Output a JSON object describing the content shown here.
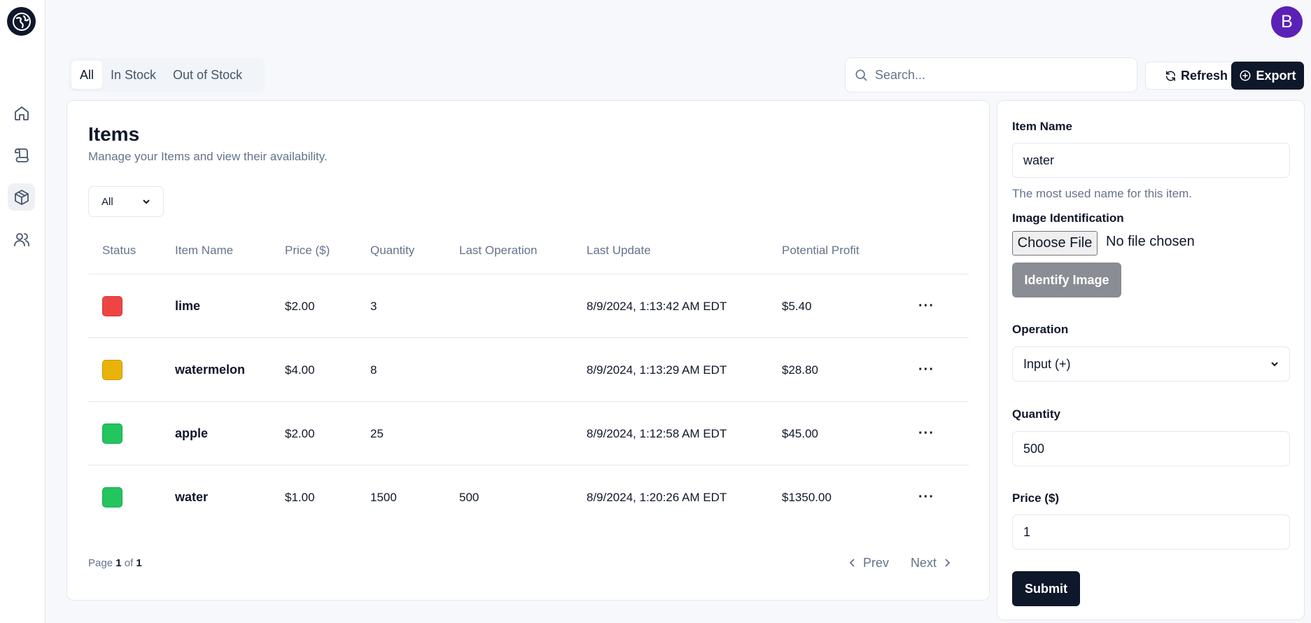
{
  "header": {
    "avatar_initial": "B"
  },
  "tabs": [
    {
      "label": "All",
      "active": true
    },
    {
      "label": "In Stock",
      "active": false
    },
    {
      "label": "Out of Stock",
      "active": false
    }
  ],
  "search": {
    "placeholder": "Search..."
  },
  "toolbar": {
    "refresh_label": "Refresh",
    "export_label": "Export"
  },
  "items_card": {
    "title": "Items",
    "subtitle": "Manage your Items and view their availability.",
    "filter_value": "All",
    "columns": [
      "Status",
      "Item Name",
      "Price ($)",
      "Quantity",
      "Last Operation",
      "Last Update",
      "Potential Profit"
    ],
    "rows": [
      {
        "status_color": "#ef4444",
        "name": "lime",
        "price": "$2.00",
        "quantity": "3",
        "last_operation": "",
        "last_update": "8/9/2024, 1:13:42 AM EDT",
        "profit": "$5.40"
      },
      {
        "status_color": "#eab308",
        "name": "watermelon",
        "price": "$4.00",
        "quantity": "8",
        "last_operation": "",
        "last_update": "8/9/2024, 1:13:29 AM EDT",
        "profit": "$28.80"
      },
      {
        "status_color": "#22c55e",
        "name": "apple",
        "price": "$2.00",
        "quantity": "25",
        "last_operation": "",
        "last_update": "8/9/2024, 1:12:58 AM EDT",
        "profit": "$45.00"
      },
      {
        "status_color": "#22c55e",
        "name": "water",
        "price": "$1.00",
        "quantity": "1500",
        "last_operation": "500",
        "last_update": "8/9/2024, 1:20:26 AM EDT",
        "profit": "$1350.00"
      }
    ],
    "pagination": {
      "page_word": "Page",
      "current": "1",
      "of_word": "of",
      "total": "1",
      "prev_label": "Prev",
      "next_label": "Next"
    }
  },
  "form": {
    "item_name_label": "Item Name",
    "item_name_value": "water",
    "item_name_hint": "The most used name for this item.",
    "image_label": "Image Identification",
    "choose_file_label": "Choose File",
    "no_file_text": "No file chosen",
    "identify_label": "Identify Image",
    "operation_label": "Operation",
    "operation_value": "Input (+)",
    "quantity_label": "Quantity",
    "quantity_value": "500",
    "price_label": "Price ($)",
    "price_value": "1",
    "submit_label": "Submit"
  },
  "colors": {
    "primary": "#0f172a",
    "avatar": "#5b21b6",
    "muted": "#64748b"
  }
}
